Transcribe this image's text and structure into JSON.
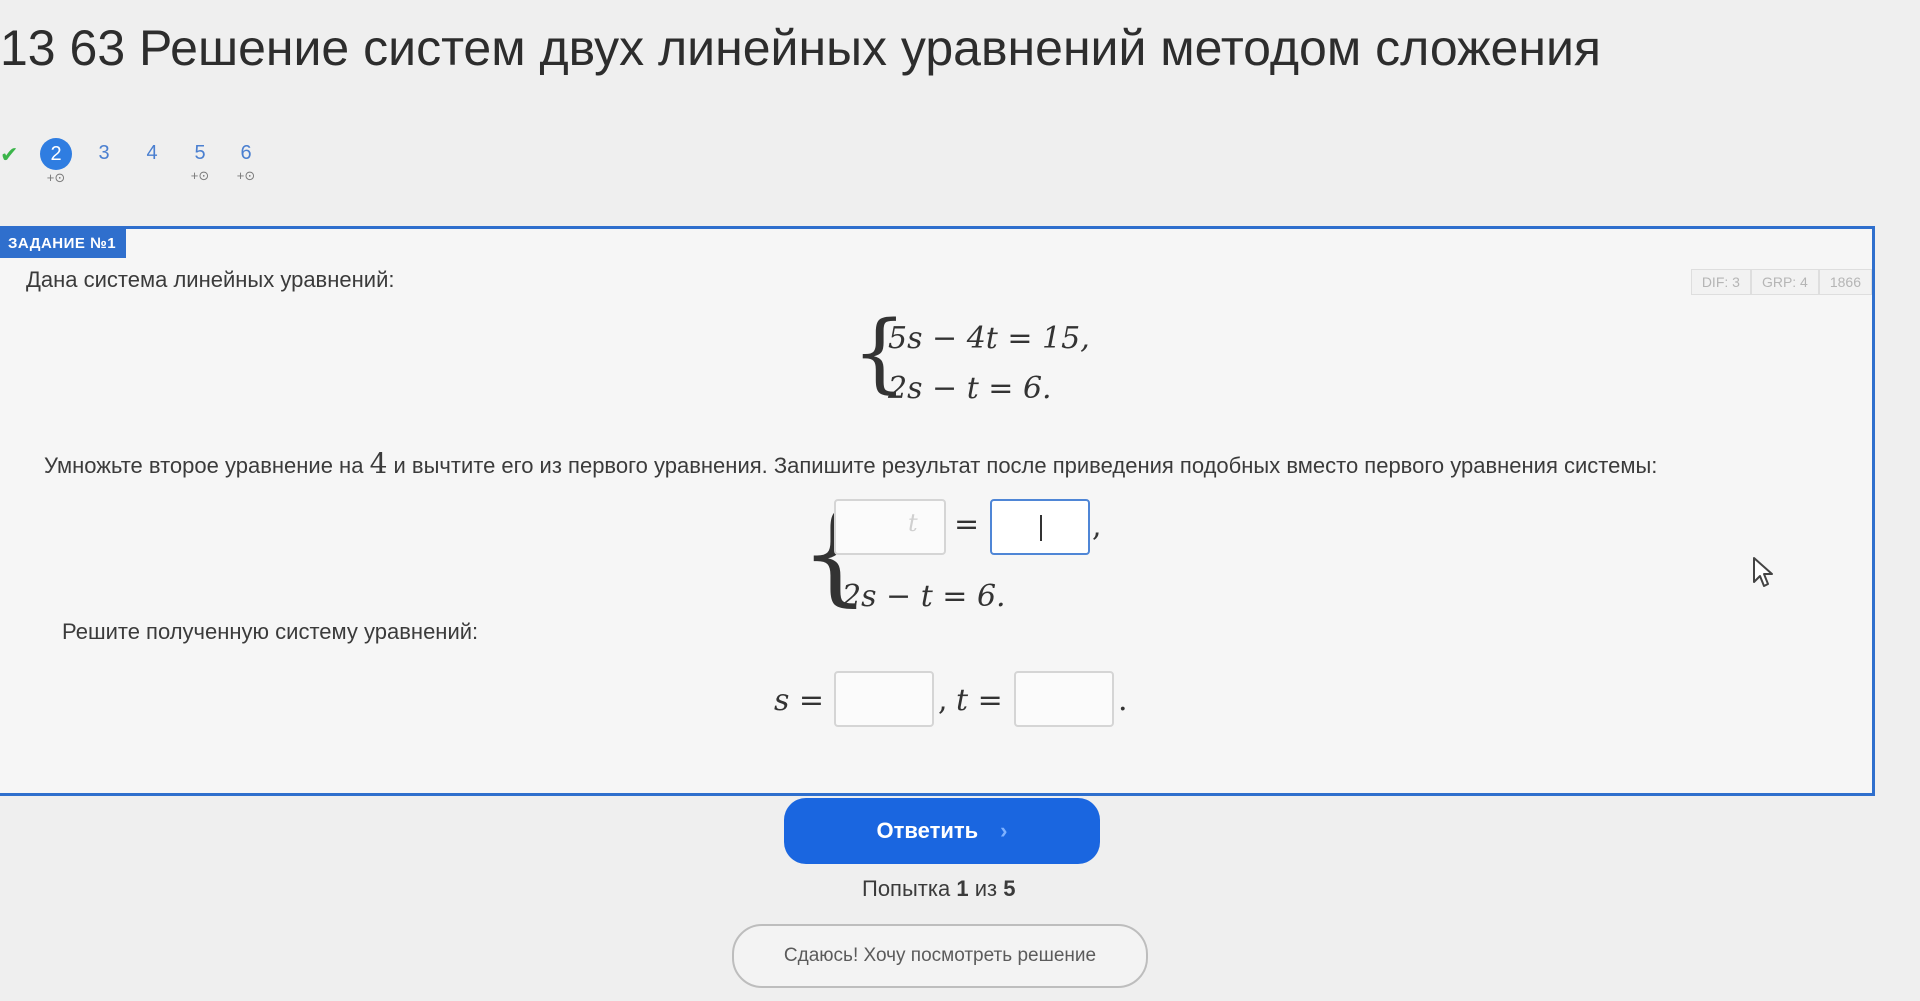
{
  "title": "13 63 Решение систем двух линейных уравнений методом сложения",
  "stepper": {
    "steps": [
      {
        "num": "2",
        "bonus": "+⊙"
      },
      {
        "num": "3",
        "bonus": ""
      },
      {
        "num": "4",
        "bonus": ""
      },
      {
        "num": "5",
        "bonus": "+⊙"
      },
      {
        "num": "6",
        "bonus": "+⊙"
      }
    ]
  },
  "task": {
    "tag": "ЗАДАНИЕ №1",
    "meta": {
      "dif": "DIF: 3",
      "grp": "GRP: 4",
      "id": "1866"
    },
    "intro": "Дана система линейных уравнений:",
    "system1": {
      "eq1": "5s − 4t = 15,",
      "eq2": "2s − t = 6."
    },
    "instruction_part1": "Умножьте второе уравнение на",
    "instruction_number": "4",
    "instruction_part2": "и вычтите его из первого уравнения. Запишите результат после приведения подобных вместо первого уравнения системы:",
    "system2": {
      "equals": "=",
      "comma": ",",
      "eq2": "2s − t = 6.",
      "ghost_hint": "t"
    },
    "solve_text": "Решите полученную систему уравнений:",
    "solution": {
      "s_label": "s =",
      "sep": ",",
      "t_label": "t =",
      "dot": "."
    }
  },
  "answer_button": {
    "label": "Ответить",
    "chevron": "›"
  },
  "attempt": {
    "prefix": "Попытка",
    "current": "1",
    "middle": "из",
    "total": "5"
  },
  "giveup_button": {
    "label": "Сдаюсь! Хочу посмотреть решение"
  }
}
